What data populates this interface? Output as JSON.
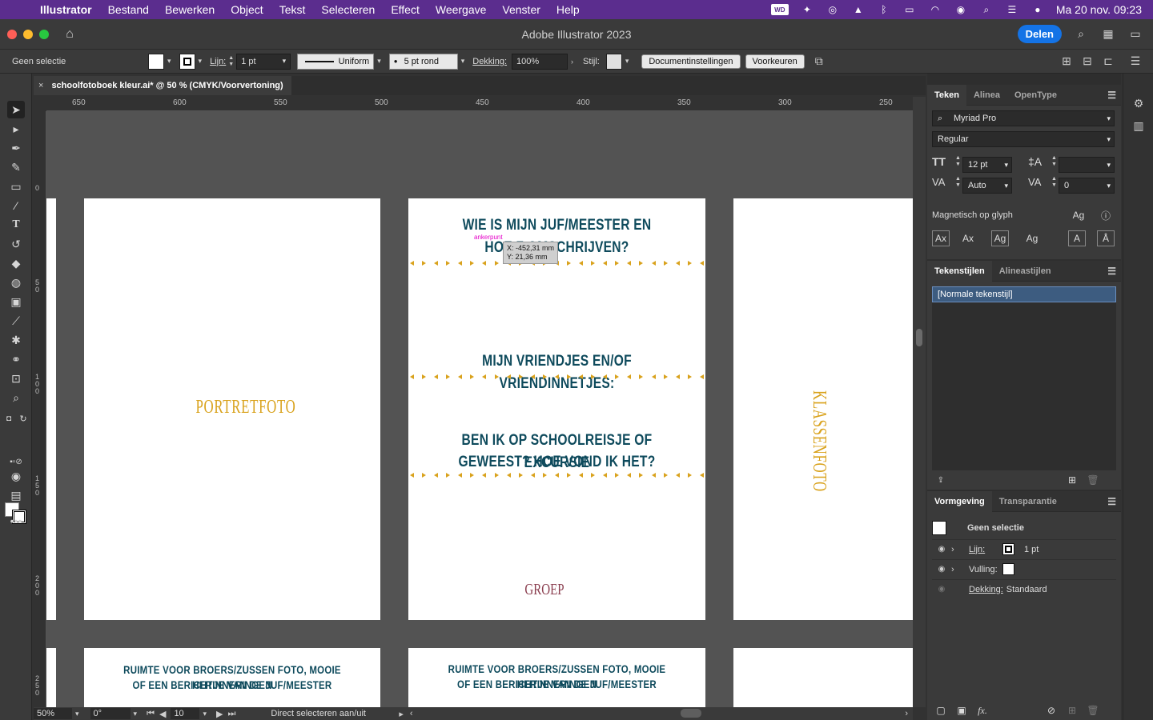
{
  "menubar": {
    "apple": "",
    "items": [
      "Illustrator",
      "Bestand",
      "Bewerken",
      "Object",
      "Tekst",
      "Selecteren",
      "Effect",
      "Weergave",
      "Venster",
      "Help"
    ],
    "status_wd": "WD",
    "clock": "Ma 20 nov.  09:23"
  },
  "titlebar": {
    "title": "Adobe Illustrator 2023",
    "share": "Delen"
  },
  "controlbar": {
    "selection": "Geen selectie",
    "stroke_label": "Lijn:",
    "stroke_weight": "1 pt",
    "profile": "Uniform",
    "brush": "5 pt rond",
    "opacity_label": "Dekking:",
    "opacity_value": "100%",
    "style_label": "Stijl:",
    "doc_settings": "Documentinstellingen",
    "preferences": "Voorkeuren"
  },
  "document_tab": {
    "close": "×",
    "title": "schoolfotoboek kleur.ai* @ 50 % (CMYK/Voorvertoning)"
  },
  "ruler": {
    "h_ticks": [
      "650",
      "600",
      "550",
      "500",
      "450",
      "400",
      "350",
      "300",
      "250"
    ],
    "v_ticks": [
      "0",
      "50",
      "100",
      "150",
      "200",
      "250"
    ]
  },
  "artboards": {
    "portret": "PORTRETFOTO",
    "q1_line1": "WIE IS MIJN JUF/MEESTER EN",
    "q1_line2": "HOE Z          OMSCHRIJVEN?",
    "q2": "MIJN VRIENDJES EN/OF VRIENDINNETJES:",
    "q3_line1": "BEN IK OP SCHOOLREISJE OF EXCURSIE",
    "q3_line2": "GEWEEST? HOE VOND IK HET?",
    "groep": "GROEP",
    "klassenfoto": "KLASSENFOTO",
    "bottom_left_line1": "RUIMTE VOOR BROERS/ZUSSEN FOTO, MOOIE HERINNERINGEN",
    "bottom_left_line2": "OF EEN BERICHTJE VAN DE JUF/MEESTER",
    "bottom_mid_line1": "RUIMTE VOOR BROERS/ZUSSEN FOTO, MOOIE HERINNERINGEN",
    "bottom_mid_line2": "OF EEN BERICHTJE VAN DE JUF/MEESTER"
  },
  "cursor": {
    "anchor_label": "ankerpunt",
    "x": "X: -452,31 mm",
    "y": "Y: 21,36 mm"
  },
  "statusbar": {
    "zoom": "50%",
    "rotation": "0°",
    "artboard": "10",
    "tool_hint": "Direct selecteren aan/uit"
  },
  "teken_panel": {
    "tabs": [
      "Teken",
      "Alinea",
      "OpenType"
    ],
    "font_family": "Myriad Pro",
    "font_style": "Regular",
    "font_size": "12 pt",
    "leading": "",
    "kerning": "Auto",
    "tracking": "0",
    "snap_label": "Magnetisch op glyph"
  },
  "styles_panel": {
    "tabs": [
      "Tekenstijlen",
      "Alineastijlen"
    ],
    "items": [
      "[Normale tekenstijl]"
    ]
  },
  "appearance_panel": {
    "tabs": [
      "Vormgeving",
      "Transparantie"
    ],
    "header": "Geen selectie",
    "stroke_label": "Lijn:",
    "stroke_value": "1 pt",
    "fill_label": "Vulling:",
    "opacity_label": "Dekking:",
    "opacity_value": "Standaard",
    "fx": "fx."
  }
}
